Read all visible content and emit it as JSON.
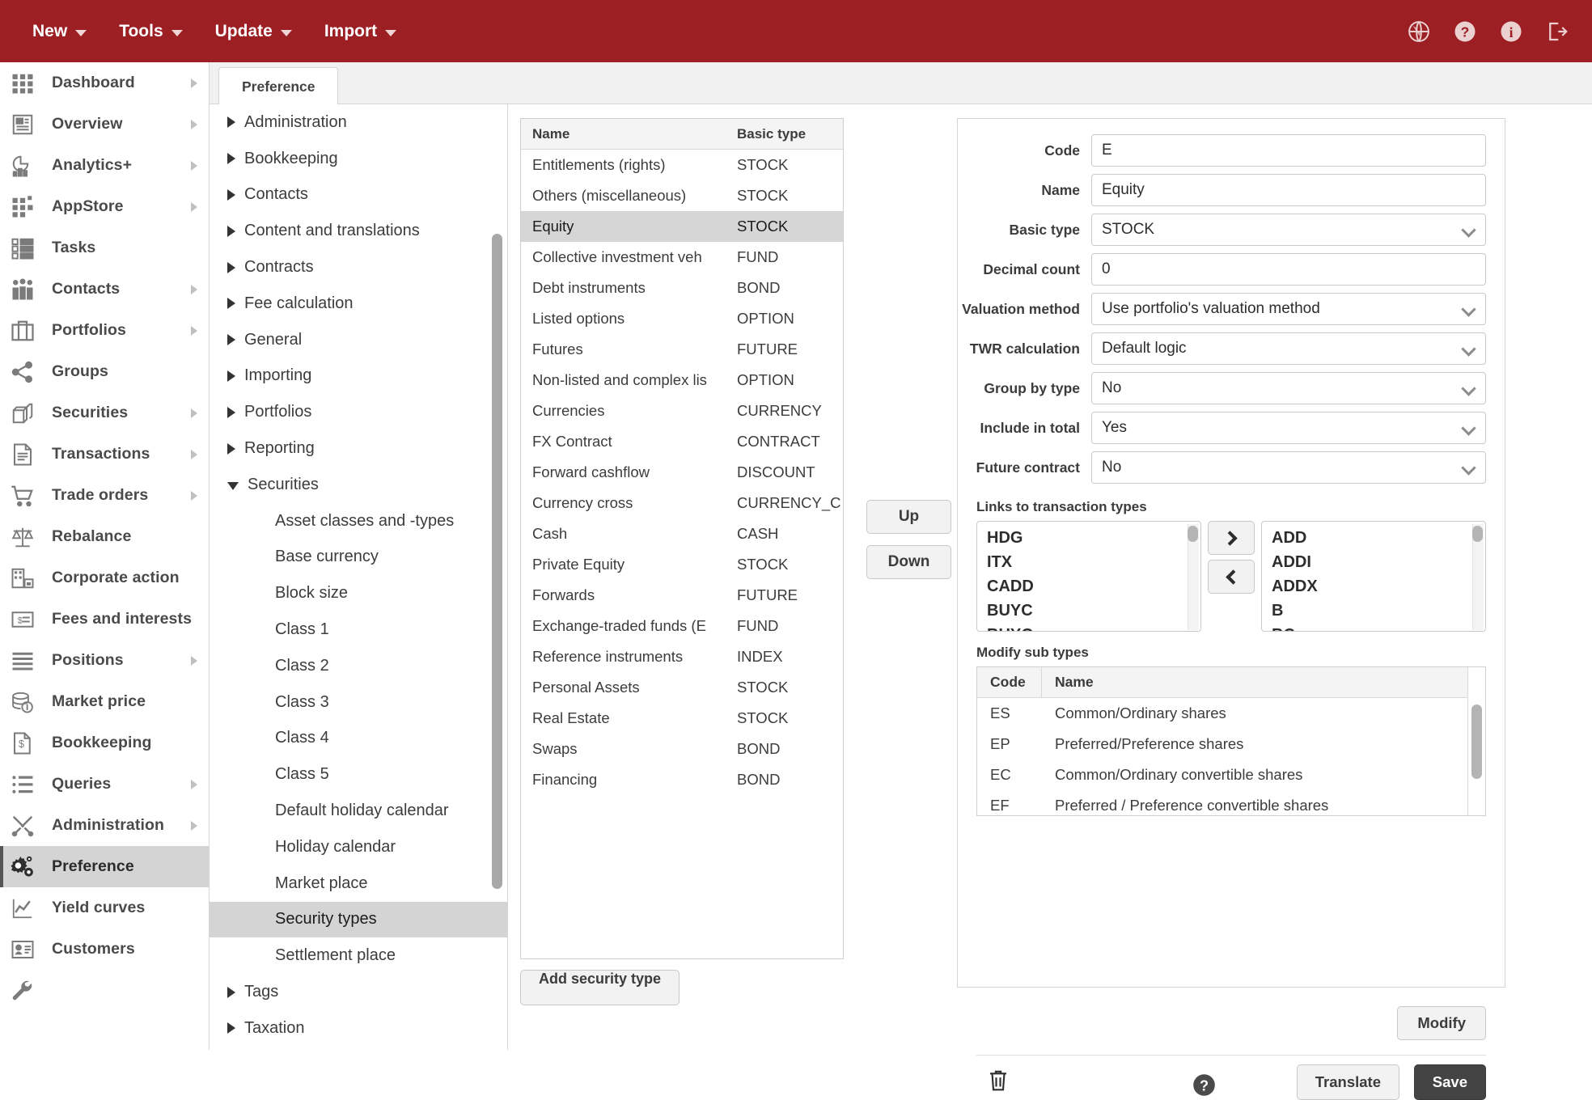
{
  "topbar": {
    "background": "#9c1f24",
    "menus": [
      {
        "label": "New",
        "icon": "chevron-down-icon"
      },
      {
        "label": "Tools",
        "icon": "chevron-down-icon"
      },
      {
        "label": "Update",
        "icon": "chevron-down-icon"
      },
      {
        "label": "Import",
        "icon": "chevron-down-icon"
      }
    ],
    "icons": [
      "globe-icon",
      "help-icon",
      "info-icon",
      "logout-icon"
    ]
  },
  "sidebar": {
    "items": [
      {
        "label": "Dashboard",
        "icon": "grid-icon",
        "expandable": true,
        "active": false
      },
      {
        "label": "Overview",
        "icon": "document-icon",
        "expandable": true,
        "active": false
      },
      {
        "label": "Analytics+",
        "icon": "chart-pie-icon",
        "expandable": true,
        "active": false
      },
      {
        "label": "AppStore",
        "icon": "apps-icon",
        "expandable": true,
        "active": false
      },
      {
        "label": "Tasks",
        "icon": "checklist-icon",
        "expandable": false,
        "active": false
      },
      {
        "label": "Contacts",
        "icon": "people-icon",
        "expandable": true,
        "active": false
      },
      {
        "label": "Portfolios",
        "icon": "briefcase-icon",
        "expandable": true,
        "active": false
      },
      {
        "label": "Groups",
        "icon": "share-icon",
        "expandable": false,
        "active": false
      },
      {
        "label": "Securities",
        "icon": "boxes-icon",
        "expandable": true,
        "active": false
      },
      {
        "label": "Transactions",
        "icon": "receipt-icon",
        "expandable": true,
        "active": false
      },
      {
        "label": "Trade orders",
        "icon": "cart-icon",
        "expandable": true,
        "active": false
      },
      {
        "label": "Rebalance",
        "icon": "scales-icon",
        "expandable": false,
        "active": false
      },
      {
        "label": "Corporate action",
        "icon": "building-icon",
        "expandable": false,
        "active": false
      },
      {
        "label": "Fees and interests",
        "icon": "invoice-icon",
        "expandable": false,
        "active": false
      },
      {
        "label": "Positions",
        "icon": "lines-icon",
        "expandable": true,
        "active": false
      },
      {
        "label": "Market price",
        "icon": "coins-icon",
        "expandable": false,
        "active": false
      },
      {
        "label": "Bookkeeping",
        "icon": "dollar-doc-icon",
        "expandable": false,
        "active": false
      },
      {
        "label": "Queries",
        "icon": "list-icon",
        "expandable": true,
        "active": false
      },
      {
        "label": "Administration",
        "icon": "tools-icon",
        "expandable": true,
        "active": false
      },
      {
        "label": "Preference",
        "icon": "gears-icon",
        "expandable": false,
        "active": true
      },
      {
        "label": "Yield curves",
        "icon": "line-chart-icon",
        "expandable": false,
        "active": false
      },
      {
        "label": "Customers",
        "icon": "id-card-icon",
        "expandable": false,
        "active": false
      },
      {
        "label": "",
        "icon": "wrench-icon",
        "expandable": false,
        "active": false
      }
    ]
  },
  "tabs": [
    {
      "label": "Preference",
      "active": true
    }
  ],
  "tree": {
    "items": [
      {
        "label": "Administration",
        "level": 1,
        "state": "closed",
        "selected": false
      },
      {
        "label": "Bookkeeping",
        "level": 1,
        "state": "closed",
        "selected": false
      },
      {
        "label": "Contacts",
        "level": 1,
        "state": "closed",
        "selected": false
      },
      {
        "label": "Content and translations",
        "level": 1,
        "state": "closed",
        "selected": false
      },
      {
        "label": "Contracts",
        "level": 1,
        "state": "closed",
        "selected": false
      },
      {
        "label": "Fee calculation",
        "level": 1,
        "state": "closed",
        "selected": false
      },
      {
        "label": "General",
        "level": 1,
        "state": "closed",
        "selected": false
      },
      {
        "label": "Importing",
        "level": 1,
        "state": "closed",
        "selected": false
      },
      {
        "label": "Portfolios",
        "level": 1,
        "state": "closed",
        "selected": false
      },
      {
        "label": "Reporting",
        "level": 1,
        "state": "closed",
        "selected": false
      },
      {
        "label": "Securities",
        "level": 1,
        "state": "open",
        "selected": false
      },
      {
        "label": "Asset classes and -types",
        "level": 2,
        "state": "leaf",
        "selected": false
      },
      {
        "label": "Base currency",
        "level": 2,
        "state": "leaf",
        "selected": false
      },
      {
        "label": "Block size",
        "level": 2,
        "state": "leaf",
        "selected": false
      },
      {
        "label": "Class 1",
        "level": 2,
        "state": "leaf",
        "selected": false
      },
      {
        "label": "Class 2",
        "level": 2,
        "state": "leaf",
        "selected": false
      },
      {
        "label": "Class 3",
        "level": 2,
        "state": "leaf",
        "selected": false
      },
      {
        "label": "Class 4",
        "level": 2,
        "state": "leaf",
        "selected": false
      },
      {
        "label": "Class 5",
        "level": 2,
        "state": "leaf",
        "selected": false
      },
      {
        "label": "Default holiday calendar",
        "level": 2,
        "state": "leaf",
        "selected": false
      },
      {
        "label": "Holiday calendar",
        "level": 2,
        "state": "leaf",
        "selected": false
      },
      {
        "label": "Market place",
        "level": 2,
        "state": "leaf",
        "selected": false
      },
      {
        "label": "Security types",
        "level": 2,
        "state": "leaf",
        "selected": true
      },
      {
        "label": "Settlement place",
        "level": 2,
        "state": "leaf",
        "selected": false
      },
      {
        "label": "Tags",
        "level": 1,
        "state": "closed",
        "selected": false
      },
      {
        "label": "Taxation",
        "level": 1,
        "state": "closed",
        "selected": false
      }
    ]
  },
  "security_types": {
    "columns": [
      "Name",
      "Basic type"
    ],
    "rows": [
      {
        "name": "Entitlements (rights)",
        "type": "STOCK",
        "selected": false
      },
      {
        "name": "Others (miscellaneous)",
        "type": "STOCK",
        "selected": false
      },
      {
        "name": "Equity",
        "type": "STOCK",
        "selected": true
      },
      {
        "name": "Collective investment veh",
        "type": "FUND",
        "selected": false
      },
      {
        "name": "Debt instruments",
        "type": "BOND",
        "selected": false
      },
      {
        "name": "Listed options",
        "type": "OPTION",
        "selected": false
      },
      {
        "name": "Futures",
        "type": "FUTURE",
        "selected": false
      },
      {
        "name": "Non-listed and complex lis",
        "type": "OPTION",
        "selected": false
      },
      {
        "name": "Currencies",
        "type": "CURRENCY",
        "selected": false
      },
      {
        "name": "FX Contract",
        "type": "CONTRACT",
        "selected": false
      },
      {
        "name": "Forward cashflow",
        "type": "DISCOUNT",
        "selected": false
      },
      {
        "name": "Currency cross",
        "type": "CURRENCY_C",
        "selected": false
      },
      {
        "name": "Cash",
        "type": "CASH",
        "selected": false
      },
      {
        "name": "Private Equity",
        "type": "STOCK",
        "selected": false
      },
      {
        "name": "Forwards",
        "type": "FUTURE",
        "selected": false
      },
      {
        "name": "Exchange-traded funds (E",
        "type": "FUND",
        "selected": false
      },
      {
        "name": "Reference instruments",
        "type": "INDEX",
        "selected": false
      },
      {
        "name": "Personal Assets",
        "type": "STOCK",
        "selected": false
      },
      {
        "name": "Real Estate",
        "type": "STOCK",
        "selected": false
      },
      {
        "name": "Swaps",
        "type": "BOND",
        "selected": false
      },
      {
        "name": "Financing",
        "type": "BOND",
        "selected": false
      }
    ],
    "add_button": "Add security type",
    "help_icon": "help-icon"
  },
  "reorder": {
    "up": "Up",
    "down": "Down"
  },
  "form": {
    "fields": [
      {
        "label": "Code",
        "value": "E",
        "kind": "text"
      },
      {
        "label": "Name",
        "value": "Equity",
        "kind": "text"
      },
      {
        "label": "Basic type",
        "value": "STOCK",
        "kind": "select"
      },
      {
        "label": "Decimal count",
        "value": "0",
        "kind": "text"
      },
      {
        "label": "Valuation method",
        "value": "Use portfolio's valuation method",
        "kind": "select"
      },
      {
        "label": "TWR calculation",
        "value": "Default logic",
        "kind": "select"
      },
      {
        "label": "Group by type",
        "value": "No",
        "kind": "select"
      },
      {
        "label": "Include in total",
        "value": "Yes",
        "kind": "select"
      },
      {
        "label": "Future contract",
        "value": "No",
        "kind": "select"
      }
    ],
    "links": {
      "title": "Links to transaction types",
      "available": [
        "HDG",
        "ITX",
        "CADD",
        "BUYC",
        "BUYO"
      ],
      "selected": [
        "ADD",
        "ADDI",
        "ADDX",
        "B",
        "BC"
      ],
      "add_icon": "chevron-right-icon",
      "remove_icon": "chevron-left-icon"
    },
    "subtypes": {
      "title": "Modify sub types",
      "columns": [
        "Code",
        "Name"
      ],
      "rows": [
        {
          "code": "ES",
          "name": "Common/Ordinary shares"
        },
        {
          "code": "EP",
          "name": "Preferred/Preference shares"
        },
        {
          "code": "EC",
          "name": "Common/Ordinary convertible shares"
        },
        {
          "code": "EF",
          "name": "Preferred / Preference convertible shares"
        }
      ],
      "modify_button": "Modify"
    },
    "footer": {
      "delete_icon": "trash-icon",
      "translate": "Translate",
      "save": "Save"
    }
  }
}
